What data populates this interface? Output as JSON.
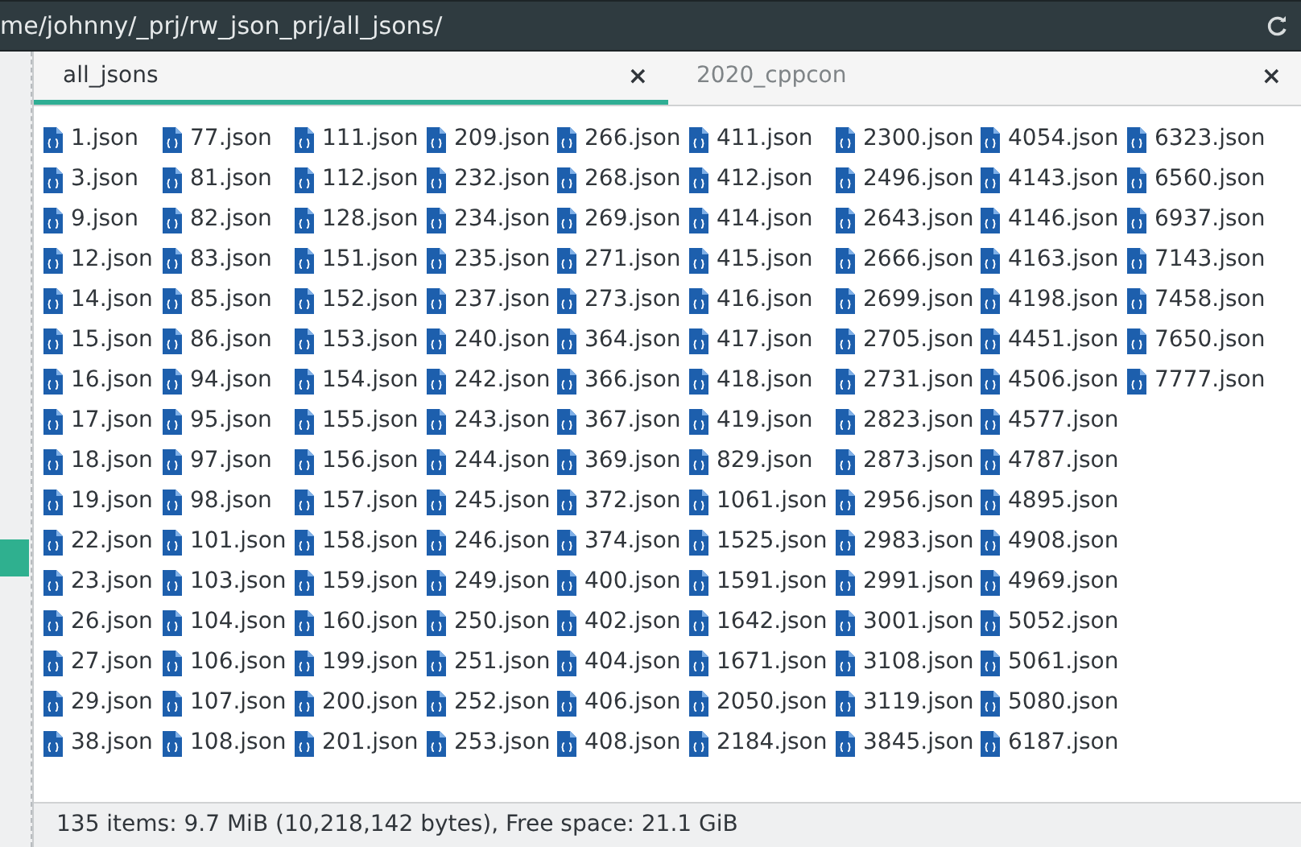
{
  "location": {
    "path": "me/johnny/_prj/rw_json_prj/all_jsons/"
  },
  "sidebar": {
    "items": [
      {
        "selected": true
      }
    ]
  },
  "tabs": [
    {
      "label": "all_jsons",
      "selected": true,
      "close": "×"
    },
    {
      "label": "2020_cppcon",
      "selected": false,
      "close": "×"
    }
  ],
  "files": [
    [
      "1.json",
      "3.json",
      "9.json",
      "12.json",
      "14.json",
      "15.json",
      "16.json",
      "17.json",
      "18.json",
      "19.json",
      "22.json",
      "23.json",
      "26.json",
      "27.json",
      "29.json",
      "38.json"
    ],
    [
      "77.json",
      "81.json",
      "82.json",
      "83.json",
      "85.json",
      "86.json",
      "94.json",
      "95.json",
      "97.json",
      "98.json",
      "101.json",
      "103.json",
      "104.json",
      "106.json",
      "107.json",
      "108.json"
    ],
    [
      "111.json",
      "112.json",
      "128.json",
      "151.json",
      "152.json",
      "153.json",
      "154.json",
      "155.json",
      "156.json",
      "157.json",
      "158.json",
      "159.json",
      "160.json",
      "199.json",
      "200.json",
      "201.json"
    ],
    [
      "209.json",
      "232.json",
      "234.json",
      "235.json",
      "237.json",
      "240.json",
      "242.json",
      "243.json",
      "244.json",
      "245.json",
      "246.json",
      "249.json",
      "250.json",
      "251.json",
      "252.json",
      "253.json"
    ],
    [
      "266.json",
      "268.json",
      "269.json",
      "271.json",
      "273.json",
      "364.json",
      "366.json",
      "367.json",
      "369.json",
      "372.json",
      "374.json",
      "400.json",
      "402.json",
      "404.json",
      "406.json",
      "408.json"
    ],
    [
      "411.json",
      "412.json",
      "414.json",
      "415.json",
      "416.json",
      "417.json",
      "418.json",
      "419.json",
      "829.json",
      "1061.json",
      "1525.json",
      "1591.json",
      "1642.json",
      "1671.json",
      "2050.json",
      "2184.json"
    ],
    [
      "2300.json",
      "2496.json",
      "2643.json",
      "2666.json",
      "2699.json",
      "2705.json",
      "2731.json",
      "2823.json",
      "2873.json",
      "2956.json",
      "2983.json",
      "2991.json",
      "3001.json",
      "3108.json",
      "3119.json",
      "3845.json"
    ],
    [
      "4054.json",
      "4143.json",
      "4146.json",
      "4163.json",
      "4198.json",
      "4451.json",
      "4506.json",
      "4577.json",
      "4787.json",
      "4895.json",
      "4908.json",
      "4969.json",
      "5052.json",
      "5061.json",
      "5080.json",
      "6187.json"
    ],
    [
      "6323.json",
      "6560.json",
      "6937.json",
      "7143.json",
      "7458.json",
      "7650.json",
      "7777.json"
    ]
  ],
  "status_bar": {
    "text": "135 items: 9.7 MiB (10,218,142 bytes), Free space: 21.1 GiB"
  }
}
